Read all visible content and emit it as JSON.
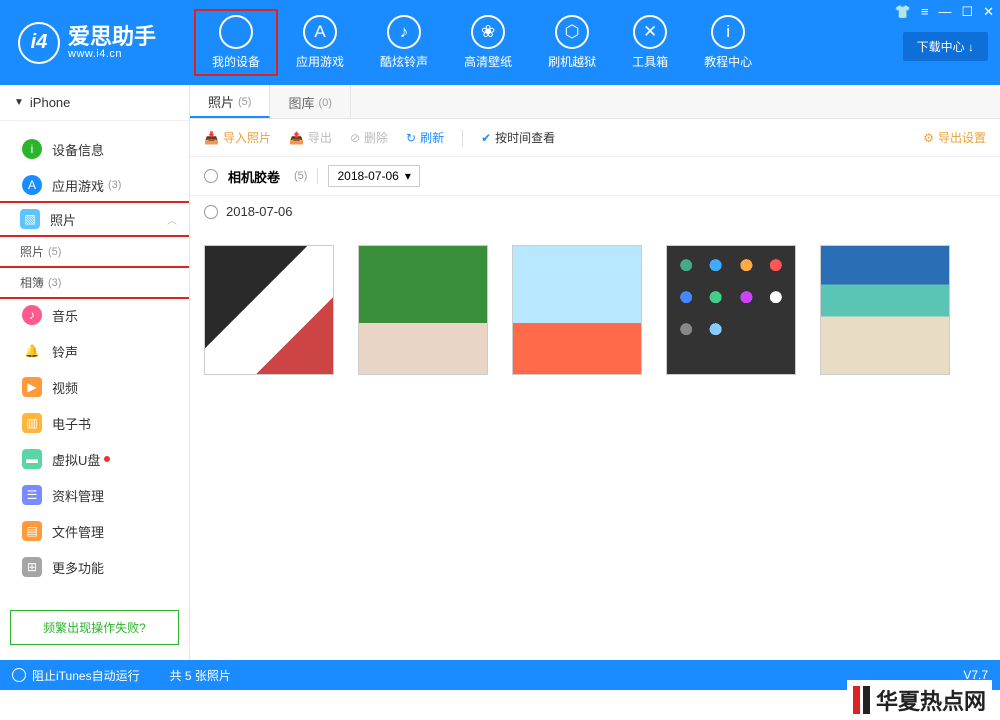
{
  "header": {
    "logo_text": "爱思助手",
    "logo_sub": "www.i4.cn",
    "nav": [
      {
        "label": "我的设备",
        "icon": ""
      },
      {
        "label": "应用游戏",
        "icon": "A"
      },
      {
        "label": "酷炫铃声",
        "icon": "♪"
      },
      {
        "label": "高清壁纸",
        "icon": "❀"
      },
      {
        "label": "刷机越狱",
        "icon": "⬡"
      },
      {
        "label": "工具箱",
        "icon": "✕"
      },
      {
        "label": "教程中心",
        "icon": "i"
      }
    ],
    "download_center": "下载中心 ↓"
  },
  "sidebar": {
    "device": "iPhone",
    "items": [
      {
        "label": "设备信息",
        "icon_bg": "#2bb52b",
        "icon": "i"
      },
      {
        "label": "应用游戏",
        "count": "(3)",
        "icon_bg": "#1a8cff",
        "icon": "A"
      },
      {
        "label": "照片",
        "icon_bg": "#5ac5ff",
        "icon": "▧",
        "expanded": true
      },
      {
        "label": "音乐",
        "icon_bg": "#ff5a8c",
        "icon": "♪"
      },
      {
        "label": "铃声",
        "icon_bg": "#68b5ff",
        "icon": "🔔"
      },
      {
        "label": "视频",
        "icon_bg": "#ff9a3a",
        "icon": "▶"
      },
      {
        "label": "电子书",
        "icon_bg": "#ffb53a",
        "icon": "▥"
      },
      {
        "label": "虚拟U盘",
        "icon_bg": "#5ad5a5",
        "icon": "▬",
        "dot": true
      },
      {
        "label": "资料管理",
        "icon_bg": "#7a8aff",
        "icon": "☰"
      },
      {
        "label": "文件管理",
        "icon_bg": "#ff9a3a",
        "icon": "▤"
      },
      {
        "label": "更多功能",
        "icon_bg": "#a5a5a5",
        "icon": "⊞"
      }
    ],
    "sub_photos": [
      {
        "label": "照片",
        "count": "(5)"
      },
      {
        "label": "相簿",
        "count": "(3)"
      }
    ],
    "help": "频繁出现操作失败?"
  },
  "tabs": [
    {
      "label": "照片",
      "count": "(5)",
      "active": true
    },
    {
      "label": "图库",
      "count": "(0)"
    }
  ],
  "toolbar": {
    "import": "导入照片",
    "export": "导出",
    "delete": "删除",
    "refresh": "刷新",
    "by_time": "按时间查看",
    "export_settings": "导出设置"
  },
  "filter": {
    "album": "相机胶卷",
    "album_count": "(5)",
    "date": "2018-07-06"
  },
  "date_group": "2018-07-06",
  "status": {
    "itunes": "阻止iTunes自动运行",
    "count": "共 5 张照片",
    "version": "V7.7"
  },
  "watermark": "华夏热点网"
}
